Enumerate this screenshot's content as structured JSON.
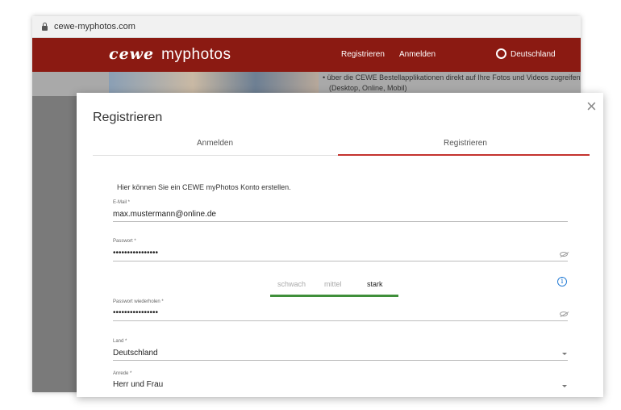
{
  "browser": {
    "url": "cewe-myphotos.com"
  },
  "site": {
    "logo_brand": "cewe",
    "logo_product": "myphotos",
    "nav": {
      "register": "Registrieren",
      "login": "Anmelden",
      "country": "Deutschland"
    },
    "bullet": "über die CEWE Bestellapplikationen direkt auf Ihre Fotos und Videos zugreifen",
    "bullet_sub": "(Desktop, Online, Mobil)"
  },
  "dialog": {
    "title": "Registrieren",
    "close_glyph": "×",
    "tabs": [
      {
        "label": "Anmelden"
      },
      {
        "label": "Registrieren"
      }
    ],
    "active_tab": "Registrieren",
    "intro": "Hier können Sie ein CEWE myPhotos Konto erstellen.",
    "fields": {
      "email": {
        "label": "E-Mail *",
        "value": "max.mustermann@online.de"
      },
      "password": {
        "label": "Passwort *",
        "value": "••••••••••••••••"
      },
      "password_repeat": {
        "label": "Passwort wiederholen *",
        "value": "••••••••••••••••"
      },
      "country": {
        "label": "Land *",
        "value": "Deutschland"
      },
      "salutation": {
        "label": "Anrede *",
        "value": "Herr und Frau"
      }
    },
    "strength": {
      "weak": "schwach",
      "medium": "mittel",
      "strong": "stark",
      "level": "stark"
    },
    "info_glyph": "i"
  },
  "colors": {
    "brand_red": "#8b1a12",
    "tab_active": "#c4322e",
    "strength_strong": "#3f8f3a",
    "info_blue": "#2a7fd6"
  }
}
